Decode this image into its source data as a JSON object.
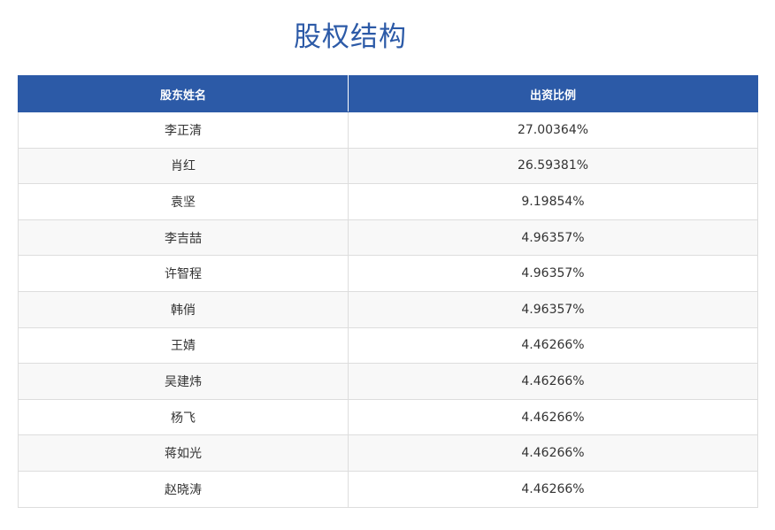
{
  "page": {
    "title": "股权结构"
  },
  "table": {
    "headers": [
      "股东姓名",
      "出资比例"
    ],
    "rows": [
      {
        "name": "李正清",
        "ratio": "27.00364%"
      },
      {
        "name": "肖红",
        "ratio": "26.59381%"
      },
      {
        "name": "袁坚",
        "ratio": "9.19854%"
      },
      {
        "name": "李吉喆",
        "ratio": "4.96357%"
      },
      {
        "name": "许智程",
        "ratio": "4.96357%"
      },
      {
        "name": "韩俏",
        "ratio": "4.96357%"
      },
      {
        "name": "王婧",
        "ratio": "4.46266%"
      },
      {
        "name": "吴建炜",
        "ratio": "4.46266%"
      },
      {
        "name": "杨飞",
        "ratio": "4.46266%"
      },
      {
        "name": "蒋如光",
        "ratio": "4.46266%"
      },
      {
        "name": "赵晓涛",
        "ratio": "4.46266%"
      }
    ]
  },
  "colors": {
    "accent": "#2c5aa7",
    "header_text": "#ffffff",
    "body_text": "#333333",
    "stripe": "#f8f8f8",
    "border": "#dddddd"
  }
}
